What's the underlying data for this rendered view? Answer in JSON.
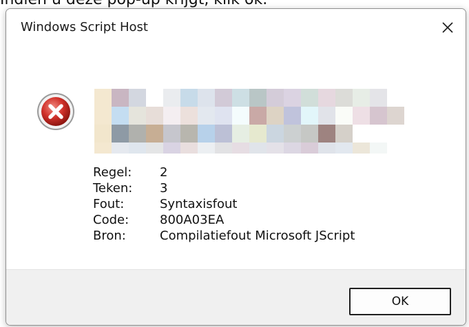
{
  "caption": "Indien u deze pop-up krijgt, klik ok.",
  "dialog": {
    "title": "Windows Script Host",
    "close_icon": "close-icon",
    "error_icon": "error-icon",
    "details": [
      {
        "label": "Regel:",
        "value": "2"
      },
      {
        "label": "Teken:",
        "value": "3"
      },
      {
        "label": "Fout:",
        "value": "Syntaxisfout"
      },
      {
        "label": "Code:",
        "value": "800A03EA"
      },
      {
        "label": "Bron:",
        "value": "Compilatiefout Microsoft JScript"
      }
    ],
    "ok_label": "OK"
  }
}
